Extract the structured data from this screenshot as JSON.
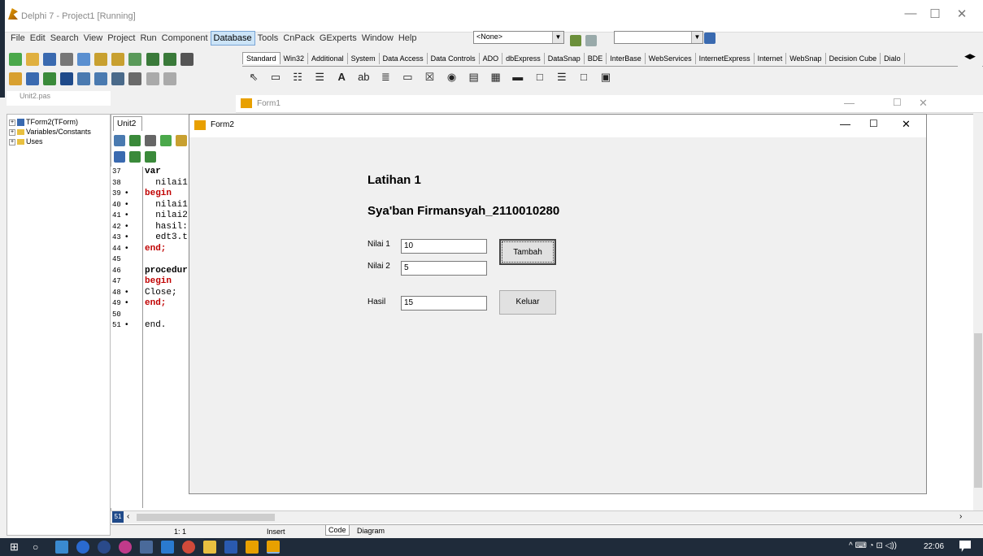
{
  "window": {
    "title": "Delphi 7 - Project1 [Running]",
    "minimize": "—",
    "maximize": "☐",
    "close": "✕"
  },
  "menu": [
    "File",
    "Edit",
    "Search",
    "View",
    "Project",
    "Run",
    "Component",
    "Database",
    "Tools",
    "CnPack",
    "GExperts",
    "Window",
    "Help"
  ],
  "menu_active": "Database",
  "combo_none": "<None>",
  "palette_tabs": [
    "Standard",
    "Win32",
    "Additional",
    "System",
    "Data Access",
    "Data Controls",
    "ADO",
    "dbExpress",
    "DataSnap",
    "BDE",
    "InterBase",
    "WebServices",
    "InternetExpress",
    "Internet",
    "WebSnap",
    "Decision Cube",
    "Dialo"
  ],
  "palette_selected": "Standard",
  "explorer": {
    "file_tab": "Unit2.pas",
    "items": [
      "TForm2(TForm)",
      "Variables/Constants",
      "Uses"
    ]
  },
  "editor": {
    "tab": "Unit2",
    "lines": [
      {
        "n": "37",
        "bp": "",
        "text": "var"
      },
      {
        "n": "38",
        "bp": "",
        "text": "  nilai1"
      },
      {
        "n": "39",
        "bp": "•",
        "text": "begin"
      },
      {
        "n": "40",
        "bp": "•",
        "text": "  nilai1"
      },
      {
        "n": "41",
        "bp": "•",
        "text": "  nilai2"
      },
      {
        "n": "42",
        "bp": "•",
        "text": "  hasil:"
      },
      {
        "n": "43",
        "bp": "•",
        "text": "  edt3.t"
      },
      {
        "n": "44",
        "bp": "•",
        "text": "end;"
      },
      {
        "n": "45",
        "bp": "",
        "text": ""
      },
      {
        "n": "46",
        "bp": "",
        "text": "procedur"
      },
      {
        "n": "47",
        "bp": "",
        "text": "begin"
      },
      {
        "n": "48",
        "bp": "•",
        "text": "Close;"
      },
      {
        "n": "49",
        "bp": "•",
        "text": "end;"
      },
      {
        "n": "50",
        "bp": "",
        "text": ""
      },
      {
        "n": "51",
        "bp": "•",
        "text": "end."
      }
    ],
    "scroll_marker": "51"
  },
  "status": {
    "position": "1: 1",
    "mode": "Insert",
    "tab_code": "Code",
    "tab_diagram": "Diagram"
  },
  "form1": {
    "title": "Form1"
  },
  "form2": {
    "title": "Form2",
    "heading1": "Latihan 1",
    "heading2": "Sya'ban Firmansyah_2110010280",
    "label_nilai1": "Nilai 1",
    "label_nilai2": "Nilai 2",
    "label_hasil": "Hasil",
    "value_nilai1": "10",
    "value_nilai2": "5",
    "value_hasil": "15",
    "btn_tambah": "Tambah",
    "btn_keluar": "Keluar"
  },
  "taskbar": {
    "clock": "22:06",
    "tray": "^ ⌨ ◔ ⊡ ◁))"
  },
  "colors": {
    "taskbar": "#1f2b3a",
    "keyword": "#c00000",
    "menu_active": "#cce4f7"
  }
}
